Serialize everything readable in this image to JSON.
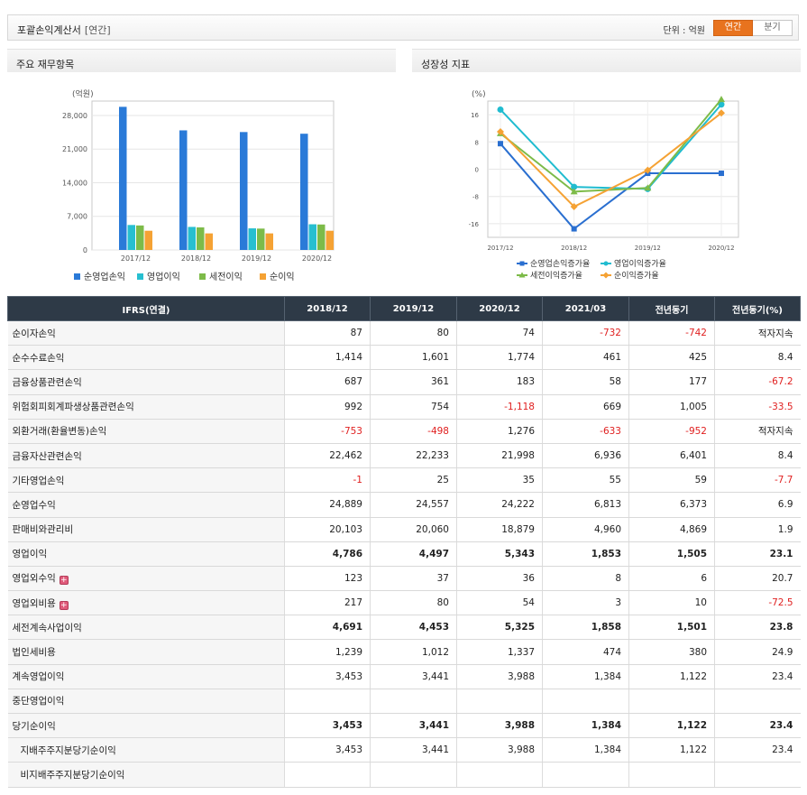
{
  "header": {
    "title": "포괄손익계산서",
    "subtitle": "[연간]",
    "unit_label": "단위 : 억원",
    "tabs": [
      "연간",
      "분기"
    ],
    "active_tab": "연간"
  },
  "left_panel": {
    "title": "주요 재무항목"
  },
  "right_panel": {
    "title": "성장성 지표"
  },
  "chart_data": [
    {
      "type": "bar",
      "ylabel": "(억원)",
      "categories": [
        "2017/12",
        "2018/12",
        "2019/12",
        "2020/12"
      ],
      "ylim": [
        0,
        31000
      ],
      "yticks": [
        "0",
        "7,000",
        "14,000",
        "21,000",
        "28,000"
      ],
      "ytick_values": [
        0,
        7000,
        14000,
        21000,
        28000
      ],
      "series": [
        {
          "name": "순영업손익",
          "color": "#2a7ad8",
          "values": [
            29800,
            24900,
            24550,
            24200
          ]
        },
        {
          "name": "영업이익",
          "color": "#27bfd0",
          "values": [
            5200,
            4800,
            4500,
            5350
          ]
        },
        {
          "name": "세전이익",
          "color": "#7dbb49",
          "values": [
            5100,
            4700,
            4450,
            5300
          ]
        },
        {
          "name": "순이익",
          "color": "#f5a234",
          "values": [
            4000,
            3450,
            3450,
            4000
          ]
        }
      ]
    },
    {
      "type": "line",
      "ylabel": "(%)",
      "categories": [
        "2017/12",
        "2018/12",
        "2019/12",
        "2020/12"
      ],
      "ylim": [
        -20,
        20
      ],
      "yticks": [
        "-16",
        "-8",
        "0",
        "8",
        "16"
      ],
      "ytick_values": [
        -16,
        -8,
        0,
        8,
        16
      ],
      "series": [
        {
          "name": "순영업손익증가율",
          "color": "#2a6fd0",
          "marker": "square",
          "values": [
            7.5,
            -17.5,
            -1.2,
            -1.2
          ]
        },
        {
          "name": "영업이익증가율",
          "color": "#20bcd0",
          "marker": "circle",
          "values": [
            17.5,
            -5.2,
            -5.8,
            19.0
          ]
        },
        {
          "name": "세전이익증가율",
          "color": "#7dbb49",
          "marker": "triangle",
          "values": [
            10.5,
            -6.6,
            -5.5,
            20.5
          ]
        },
        {
          "name": "순이익증가율",
          "color": "#f5a234",
          "marker": "diamond",
          "values": [
            11.0,
            -11.0,
            -0.3,
            16.5
          ]
        }
      ]
    }
  ],
  "table": {
    "headers": [
      "IFRS(연결)",
      "2018/12",
      "2019/12",
      "2020/12",
      "2021/03",
      "전년동기",
      "전년동기(%)"
    ],
    "rows": [
      {
        "label": "순이자손익",
        "values": [
          "87",
          "80",
          "74",
          "-732",
          "-742",
          "적자지속"
        ]
      },
      {
        "label": "순수수료손익",
        "values": [
          "1,414",
          "1,601",
          "1,774",
          "461",
          "425",
          "8.4"
        ]
      },
      {
        "label": "금융상품관련손익",
        "values": [
          "687",
          "361",
          "183",
          "58",
          "177",
          "-67.2"
        ]
      },
      {
        "label": "위험회피회계파생상품관련손익",
        "values": [
          "992",
          "754",
          "-1,118",
          "669",
          "1,005",
          "-33.5"
        ]
      },
      {
        "label": "외환거래(환율변동)손익",
        "values": [
          "-753",
          "-498",
          "1,276",
          "-633",
          "-952",
          "적자지속"
        ]
      },
      {
        "label": "금융자산관련손익",
        "values": [
          "22,462",
          "22,233",
          "21,998",
          "6,936",
          "6,401",
          "8.4"
        ]
      },
      {
        "label": "기타영업손익",
        "values": [
          "-1",
          "25",
          "35",
          "55",
          "59",
          "-7.7"
        ]
      },
      {
        "label": "순영업수익",
        "values": [
          "24,889",
          "24,557",
          "24,222",
          "6,813",
          "6,373",
          "6.9"
        ]
      },
      {
        "label": "판매비와관리비",
        "values": [
          "20,103",
          "20,060",
          "18,879",
          "4,960",
          "4,869",
          "1.9"
        ]
      },
      {
        "label": "영업이익",
        "bold": true,
        "values": [
          "4,786",
          "4,497",
          "5,343",
          "1,853",
          "1,505",
          "23.1"
        ]
      },
      {
        "label": "영업외수익",
        "expand": true,
        "values": [
          "123",
          "37",
          "36",
          "8",
          "6",
          "20.7"
        ]
      },
      {
        "label": "영업외비용",
        "expand": true,
        "values": [
          "217",
          "80",
          "54",
          "3",
          "10",
          "-72.5"
        ]
      },
      {
        "label": "세전계속사업이익",
        "bold": true,
        "values": [
          "4,691",
          "4,453",
          "5,325",
          "1,858",
          "1,501",
          "23.8"
        ]
      },
      {
        "label": "법인세비용",
        "values": [
          "1,239",
          "1,012",
          "1,337",
          "474",
          "380",
          "24.9"
        ]
      },
      {
        "label": "계속영업이익",
        "values": [
          "3,453",
          "3,441",
          "3,988",
          "1,384",
          "1,122",
          "23.4"
        ]
      },
      {
        "label": "중단영업이익",
        "values": [
          "",
          "",
          "",
          "",
          "",
          ""
        ]
      },
      {
        "label": "당기순이익",
        "bold": true,
        "values": [
          "3,453",
          "3,441",
          "3,988",
          "1,384",
          "1,122",
          "23.4"
        ]
      },
      {
        "label": "지배주주지분당기순이익",
        "indent": true,
        "values": [
          "3,453",
          "3,441",
          "3,988",
          "1,384",
          "1,122",
          "23.4"
        ]
      },
      {
        "label": "비지배주주지분당기순이익",
        "indent": true,
        "values": [
          "",
          "",
          "",
          "",
          "",
          ""
        ]
      }
    ]
  }
}
